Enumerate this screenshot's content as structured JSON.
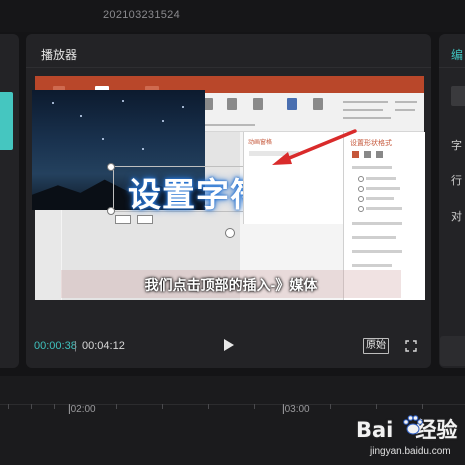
{
  "project": {
    "title": "202103231524"
  },
  "player": {
    "title": "播放器",
    "current_time": "00:00:38",
    "separator": "|",
    "total_time": "00:04:12",
    "original_ratio_label": "原始"
  },
  "right_panel": {
    "header": "编",
    "labels": [
      "字",
      "行",
      "对"
    ]
  },
  "video": {
    "slide_text": "设置字符间距",
    "anim_pane_title": "动画窗格",
    "format_pane_title": "设置形状格式",
    "subtitle": "我们点击顶部的插入-》媒体",
    "arrow_color": "#d92b2b"
  },
  "timeline": {
    "ticks": [
      "|02:00",
      "|03:00"
    ]
  },
  "watermark": {
    "text": "Bai",
    "text2": "经验",
    "url": "jingyan.baidu.com"
  }
}
